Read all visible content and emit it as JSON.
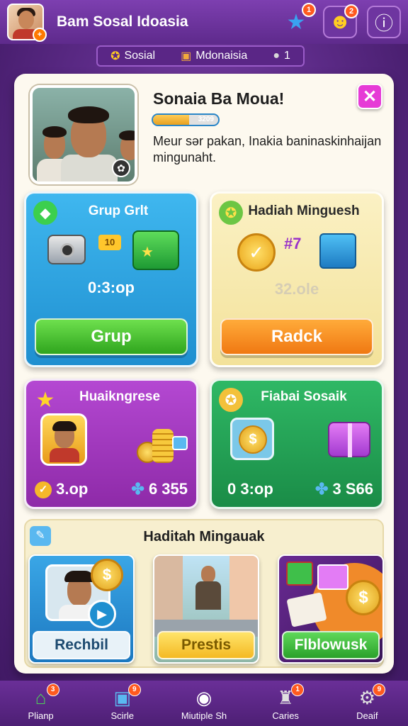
{
  "header": {
    "title": "Bam Sosal Idoasia",
    "avatar_badge": "+",
    "icons": [
      {
        "name": "star-icon",
        "glyph": "★",
        "badge": "1"
      },
      {
        "name": "emoji-icon",
        "glyph": "☻",
        "badge": "2"
      },
      {
        "name": "info-icon",
        "glyph": "ⓘ",
        "badge": ""
      }
    ]
  },
  "strip": {
    "item1": "Sosial",
    "item2": "Mdonaisia",
    "item3": "1"
  },
  "profile": {
    "title": "Sonaia Ba Moua!",
    "progress_text": "3209",
    "progress": 0.55,
    "description": "Meur sər pakan, Inakia baninaskinhaijan mingunaht.",
    "close_glyph": "✕"
  },
  "tiles": {
    "group": {
      "title": "Grup Grlt",
      "badge_text": "10",
      "value": "0:3:op",
      "button": "Grup",
      "color": "#29a6e6"
    },
    "weekly_reward": {
      "title": "Hadiah Minguesh",
      "count": "#7",
      "value": "32.ole",
      "button": "Radck",
      "color": "#f7e9a8"
    },
    "progress": {
      "title": "Huaikngrese",
      "value_left": "3.op",
      "value_right": "6 355",
      "color": "#a236c0"
    },
    "social": {
      "title": "Fiabai Sosaik",
      "value_left": "0 3:op",
      "value_right": "3 S66",
      "color": "#22a35a"
    }
  },
  "weekly": {
    "title": "Haditah Mingauak",
    "cards": [
      {
        "label": "Rechbil"
      },
      {
        "label": "Prestis"
      },
      {
        "label": "Flblowusk"
      }
    ]
  },
  "nav": [
    {
      "label": "Plianp",
      "glyph": "⌂",
      "badge": "3"
    },
    {
      "label": "Scirle",
      "glyph": "▣",
      "badge": "9"
    },
    {
      "label": "Miutiple Sh",
      "glyph": "◉",
      "badge": ""
    },
    {
      "label": "Caries",
      "glyph": "♜",
      "badge": "1"
    },
    {
      "label": "Deaif",
      "glyph": "⚙",
      "badge": "9"
    }
  ]
}
